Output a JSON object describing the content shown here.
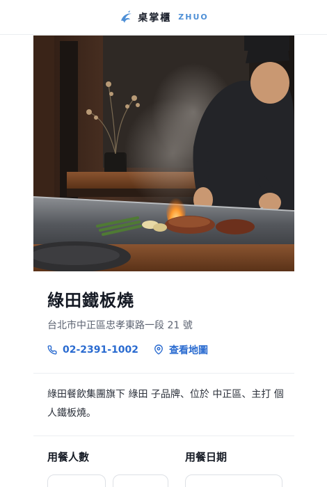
{
  "header": {
    "brand_cn": "桌掌櫃",
    "brand_en": "ZHUO",
    "logo_icon": "dragon-logo-icon",
    "accent_color": "#4e8fd6"
  },
  "hero": {
    "image": "chef-cooking-steak-on-teppanyaki-grill"
  },
  "restaurant": {
    "name": "綠田鐵板燒",
    "address": "台北市中正區忠孝東路一段 21 號",
    "phone": "02-2391-1002",
    "phone_icon": "phone-icon",
    "map_label": "查看地圖",
    "map_icon": "map-pin-icon",
    "link_color": "#2a6bd0",
    "description": "綠田餐飲集團旗下 綠田 子品牌、位於 中正區、主打 個人鐵板燒。"
  },
  "booking": {
    "people_label": "用餐人數",
    "date_label": "用餐日期"
  }
}
